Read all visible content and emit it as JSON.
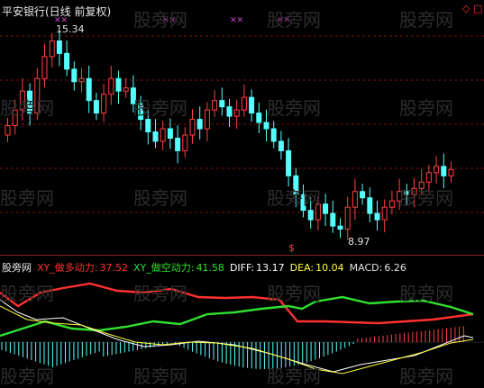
{
  "header": {
    "title": "平安银行(日线 前复权)",
    "corner_marker": "◇ □"
  },
  "price_panel": {
    "high_label": "15.34",
    "low_label": "8.97",
    "signal_marker": "$",
    "top_marks": [
      "✕✕",
      "✕✕",
      "✕✕",
      "✕✕",
      "✕✕",
      "✕✕"
    ]
  },
  "indicator_panel": {
    "source_label": "股旁网",
    "buy_power": {
      "label": "XY_做多动力:",
      "value": "37.52"
    },
    "sell_power": {
      "label": "XY_做空动力:",
      "value": "41.58"
    },
    "diff": {
      "label": "DIFF:",
      "value": "13.17"
    },
    "dea": {
      "label": "DEA:",
      "value": "10.04"
    },
    "macd": {
      "label": "MACD:",
      "value": "6.26"
    }
  },
  "watermark": "股旁网",
  "colors": {
    "up": "#ff4040",
    "down": "#54ffff",
    "buy_line": "#ff3030",
    "sell_line": "#30e030",
    "diff_line": "#ffffff",
    "dea_line": "#ffff40",
    "grid": "#7a1010"
  },
  "chart_data": {
    "type": "candlestick",
    "high": 15.34,
    "low": 8.97,
    "closes": [
      12.4,
      12.9,
      13.5,
      12.8,
      13.9,
      14.6,
      15.1,
      14.7,
      14.2,
      13.8,
      13.9,
      13.2,
      12.8,
      13.4,
      13.9,
      13.5,
      13.6,
      13.1,
      12.6,
      12.2,
      11.9,
      12.3,
      12.0,
      11.6,
      12.1,
      12.6,
      12.3,
      12.9,
      13.2,
      13.0,
      12.7,
      12.9,
      13.3,
      12.8,
      12.5,
      12.3,
      11.9,
      11.6,
      10.8,
      10.2,
      9.7,
      9.4,
      9.9,
      9.6,
      9.2,
      9.1,
      9.8,
      10.3,
      10.1,
      9.6,
      9.4,
      9.8,
      10.0,
      10.3,
      10.2,
      10.4,
      10.6,
      10.9,
      11.1,
      10.8,
      11.0
    ]
  }
}
